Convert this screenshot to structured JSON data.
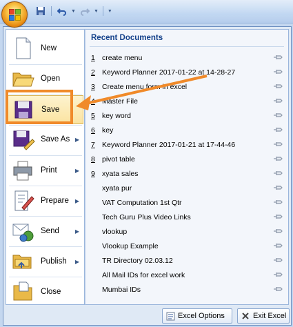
{
  "quick_access": {
    "save": "save-icon",
    "undo": "undo-icon",
    "redo": "redo-icon"
  },
  "menu": {
    "items": [
      {
        "label": "New",
        "icon": "new-document-icon",
        "has_submenu": false
      },
      {
        "label": "Open",
        "icon": "open-folder-icon",
        "has_submenu": false
      },
      {
        "label": "Save",
        "icon": "save-floppy-icon",
        "has_submenu": false
      },
      {
        "label": "Save As",
        "icon": "save-as-icon",
        "has_submenu": true
      },
      {
        "label": "Print",
        "icon": "printer-icon",
        "has_submenu": true
      },
      {
        "label": "Prepare",
        "icon": "prepare-icon",
        "has_submenu": true
      },
      {
        "label": "Send",
        "icon": "send-icon",
        "has_submenu": true
      },
      {
        "label": "Publish",
        "icon": "publish-icon",
        "has_submenu": true
      },
      {
        "label": "Close",
        "icon": "close-folder-icon",
        "has_submenu": false
      }
    ]
  },
  "recent": {
    "title": "Recent Documents",
    "items": [
      {
        "num": "1",
        "name": "create menu"
      },
      {
        "num": "2",
        "name": "Keyword Planner 2017-01-22 at 14-28-27"
      },
      {
        "num": "3",
        "name": "Create menu form in excel"
      },
      {
        "num": "4",
        "name": "Master File"
      },
      {
        "num": "5",
        "name": "key word"
      },
      {
        "num": "6",
        "name": "key"
      },
      {
        "num": "7",
        "name": "Keyword Planner 2017-01-21 at 17-44-46"
      },
      {
        "num": "8",
        "name": "pivot table"
      },
      {
        "num": "9",
        "name": "xyata sales"
      },
      {
        "num": "",
        "name": "xyata pur"
      },
      {
        "num": "",
        "name": "VAT Computation 1st Qtr"
      },
      {
        "num": "",
        "name": "Tech Guru Plus Video Links"
      },
      {
        "num": "",
        "name": "vlookup"
      },
      {
        "num": "",
        "name": "Vlookup Example"
      },
      {
        "num": "",
        "name": "TR Directory 02.03.12"
      },
      {
        "num": "",
        "name": "All Mail IDs for excel work"
      },
      {
        "num": "",
        "name": "Mumbai IDs"
      }
    ]
  },
  "footer": {
    "options_label": "Excel Options",
    "exit_label": "Exit Excel"
  },
  "colors": {
    "accent": "#15428b",
    "annotation": "#f08a2a",
    "selected_bg": "#fbe3a0"
  }
}
